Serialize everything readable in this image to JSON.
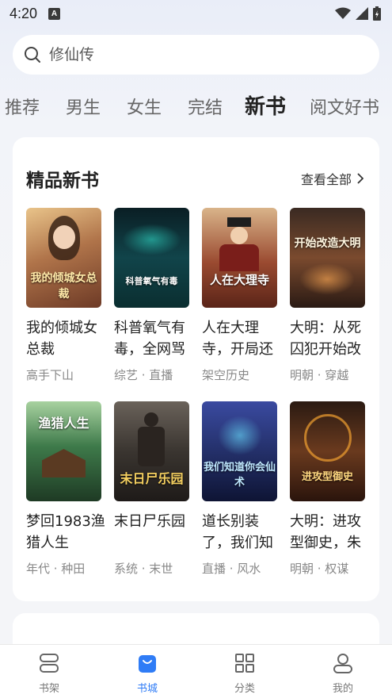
{
  "status_bar": {
    "time": "4:20",
    "notification_letter": "A"
  },
  "search": {
    "placeholder": "修仙传"
  },
  "tabs": [
    {
      "label": "推荐"
    },
    {
      "label": "男生"
    },
    {
      "label": "女生"
    },
    {
      "label": "完结"
    },
    {
      "label": "新书",
      "active": true
    },
    {
      "label": "阅文好书"
    }
  ],
  "section": {
    "title": "精品新书",
    "view_all": "查看全部"
  },
  "books": [
    {
      "title": "我的倾城女总裁",
      "tags": "高手下山",
      "cover_text": "我的倾城女总裁",
      "cover_color": "#b0744a"
    },
    {
      "title": "科普氧气有毒，全网骂",
      "tags": "综艺 · 直播",
      "cover_text": "科普氧气有毒",
      "cover_color": "#0d3a3f"
    },
    {
      "title": "人在大理寺，开局还",
      "tags": "架空历史",
      "cover_text": "人在大理寺",
      "cover_color": "#7a3b2c"
    },
    {
      "title": "大明：从死囚犯开始改",
      "tags": "明朝 · 穿越",
      "cover_text": "开始改造大明",
      "cover_color": "#5a3a2a"
    },
    {
      "title": "梦回1983渔猎人生",
      "tags": "年代 · 种田",
      "cover_text": "渔猎人生",
      "cover_color": "#2e5a3a"
    },
    {
      "title": "末日尸乐园",
      "tags": "系统 · 末世",
      "cover_text": "末日尸乐园",
      "cover_color": "#3a3530"
    },
    {
      "title": "道长别装了，我们知",
      "tags": "直播 · 风水",
      "cover_text": "我们知道你会仙术",
      "cover_color": "#24306a"
    },
    {
      "title": "大明：进攻型御史，朱",
      "tags": "明朝 · 权谋",
      "cover_text": "进攻型御史",
      "cover_color": "#4a2e1e"
    }
  ],
  "bottom_nav": [
    {
      "label": "书架",
      "icon": "bookshelf-icon"
    },
    {
      "label": "书城",
      "icon": "bookstore-icon",
      "active": true
    },
    {
      "label": "分类",
      "icon": "category-icon"
    },
    {
      "label": "我的",
      "icon": "profile-icon"
    }
  ],
  "colors": {
    "accent": "#2f7cf6",
    "background": "#f4f5f8"
  }
}
